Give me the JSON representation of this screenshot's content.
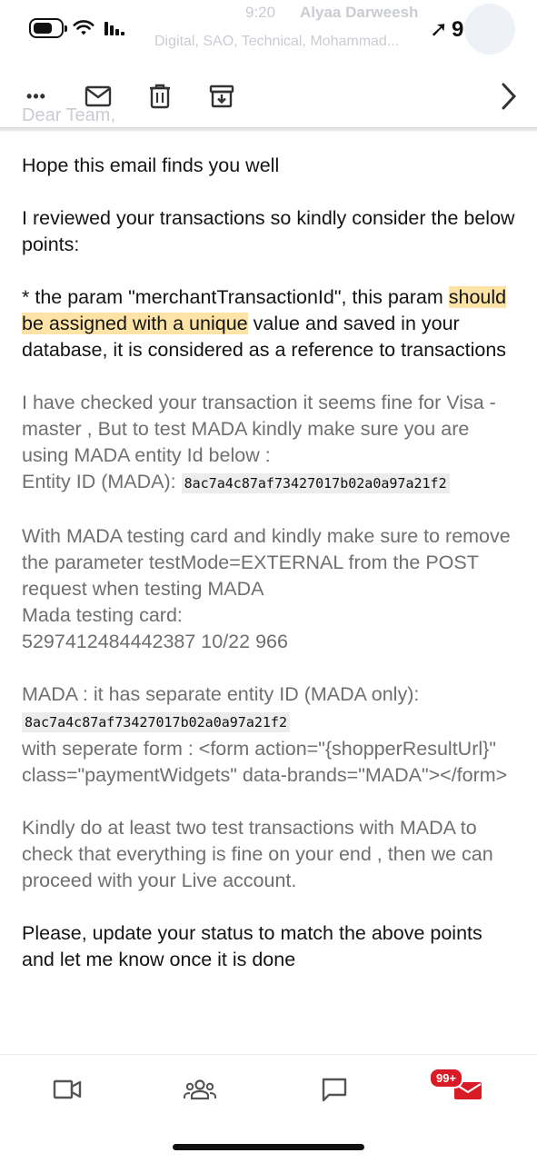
{
  "status_bar": {
    "time": "9:24",
    "battery_level": 0.7,
    "location_glyph": "➚"
  },
  "ghost_header": {
    "time": "9:20",
    "sender": "Alyaa Darweesh",
    "recipients": "Digital, SAO, Technical, Mohammad...",
    "greeting": "Dear Team,"
  },
  "toolbar": {
    "more_label": "•••",
    "icons": [
      "more-icon",
      "mark-unread-icon",
      "delete-icon",
      "archive-icon",
      "next-chevron-icon"
    ]
  },
  "email": {
    "p1": "Hope this email finds you well",
    "p2": "I reviewed your transactions so kindly consider the below points:",
    "p3_before": "* the param \"merchantTransactionId\", this param ",
    "p3_highlight": "should be assigned with a unique",
    "p3_after": " value and saved in your database, it is considered as a reference to transactions",
    "p4_line1": "I have checked your transaction it seems fine for Visa - master  , But to test MADA kindly make sure you are using MADA entity Id below :",
    "p4_entity_label": "Entity ID (MADA): ",
    "p4_entity_id": "8ac7a4c87af73427017b02a0a97a21f2",
    "p5_line1": "With MADA testing card and kindly make sure to remove the parameter testMode=EXTERNAL from the POST request when testing MADA",
    "p5_card_label": "Mada testing card:",
    "p5_card": "5297412484442387 10/22 966",
    "p6_before": "MADA :  it has separate entity ID (MADA only): ",
    "p6_entity_id": "8ac7a4c87af73427017b02a0a97a21f2",
    "p6_after": "with seperate form : <form action=\"{shopperResultUrl}\" class=\"paymentWidgets\" data-brands=\"MADA\"></form>",
    "p7": "Kindly do at least two test transactions with MADA to check that everything is fine on your end , then we can proceed with your Live account.",
    "p8": "Please, update your status to match the above points and let me know once it is done"
  },
  "bottom_nav": {
    "items": [
      "video-icon",
      "people-icon",
      "chat-icon",
      "mail-icon"
    ],
    "mail_badge": "99+"
  },
  "colors": {
    "highlight": "#fde4a6",
    "grey_text": "#6f6f6f",
    "badge": "#d81b25"
  }
}
